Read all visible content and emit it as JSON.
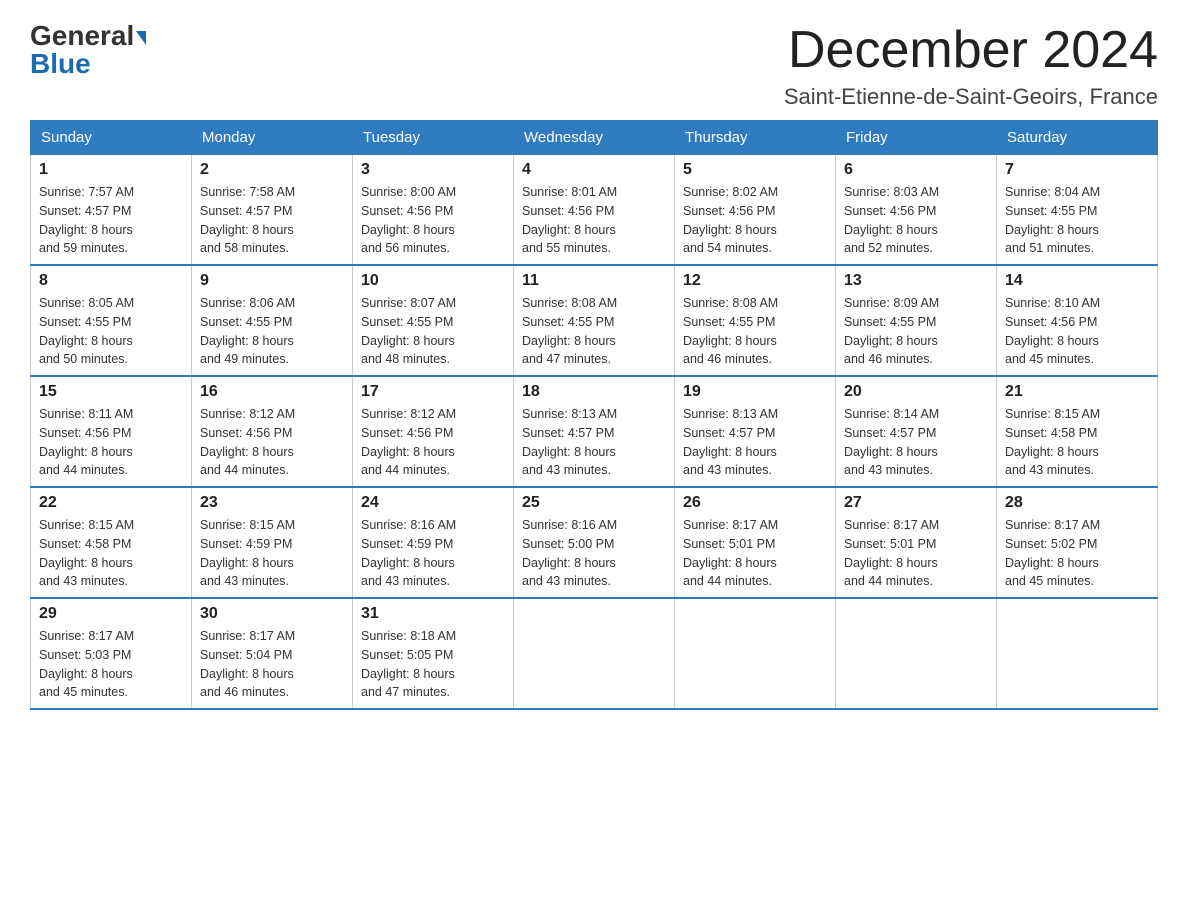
{
  "header": {
    "logo_general": "General",
    "logo_blue": "Blue",
    "title": "December 2024",
    "subtitle": "Saint-Etienne-de-Saint-Geoirs, France"
  },
  "days_of_week": [
    "Sunday",
    "Monday",
    "Tuesday",
    "Wednesday",
    "Thursday",
    "Friday",
    "Saturday"
  ],
  "weeks": [
    [
      {
        "day": "1",
        "sunrise": "7:57 AM",
        "sunset": "4:57 PM",
        "daylight": "8 hours and 59 minutes."
      },
      {
        "day": "2",
        "sunrise": "7:58 AM",
        "sunset": "4:57 PM",
        "daylight": "8 hours and 58 minutes."
      },
      {
        "day": "3",
        "sunrise": "8:00 AM",
        "sunset": "4:56 PM",
        "daylight": "8 hours and 56 minutes."
      },
      {
        "day": "4",
        "sunrise": "8:01 AM",
        "sunset": "4:56 PM",
        "daylight": "8 hours and 55 minutes."
      },
      {
        "day": "5",
        "sunrise": "8:02 AM",
        "sunset": "4:56 PM",
        "daylight": "8 hours and 54 minutes."
      },
      {
        "day": "6",
        "sunrise": "8:03 AM",
        "sunset": "4:56 PM",
        "daylight": "8 hours and 52 minutes."
      },
      {
        "day": "7",
        "sunrise": "8:04 AM",
        "sunset": "4:55 PM",
        "daylight": "8 hours and 51 minutes."
      }
    ],
    [
      {
        "day": "8",
        "sunrise": "8:05 AM",
        "sunset": "4:55 PM",
        "daylight": "8 hours and 50 minutes."
      },
      {
        "day": "9",
        "sunrise": "8:06 AM",
        "sunset": "4:55 PM",
        "daylight": "8 hours and 49 minutes."
      },
      {
        "day": "10",
        "sunrise": "8:07 AM",
        "sunset": "4:55 PM",
        "daylight": "8 hours and 48 minutes."
      },
      {
        "day": "11",
        "sunrise": "8:08 AM",
        "sunset": "4:55 PM",
        "daylight": "8 hours and 47 minutes."
      },
      {
        "day": "12",
        "sunrise": "8:08 AM",
        "sunset": "4:55 PM",
        "daylight": "8 hours and 46 minutes."
      },
      {
        "day": "13",
        "sunrise": "8:09 AM",
        "sunset": "4:55 PM",
        "daylight": "8 hours and 46 minutes."
      },
      {
        "day": "14",
        "sunrise": "8:10 AM",
        "sunset": "4:56 PM",
        "daylight": "8 hours and 45 minutes."
      }
    ],
    [
      {
        "day": "15",
        "sunrise": "8:11 AM",
        "sunset": "4:56 PM",
        "daylight": "8 hours and 44 minutes."
      },
      {
        "day": "16",
        "sunrise": "8:12 AM",
        "sunset": "4:56 PM",
        "daylight": "8 hours and 44 minutes."
      },
      {
        "day": "17",
        "sunrise": "8:12 AM",
        "sunset": "4:56 PM",
        "daylight": "8 hours and 44 minutes."
      },
      {
        "day": "18",
        "sunrise": "8:13 AM",
        "sunset": "4:57 PM",
        "daylight": "8 hours and 43 minutes."
      },
      {
        "day": "19",
        "sunrise": "8:13 AM",
        "sunset": "4:57 PM",
        "daylight": "8 hours and 43 minutes."
      },
      {
        "day": "20",
        "sunrise": "8:14 AM",
        "sunset": "4:57 PM",
        "daylight": "8 hours and 43 minutes."
      },
      {
        "day": "21",
        "sunrise": "8:15 AM",
        "sunset": "4:58 PM",
        "daylight": "8 hours and 43 minutes."
      }
    ],
    [
      {
        "day": "22",
        "sunrise": "8:15 AM",
        "sunset": "4:58 PM",
        "daylight": "8 hours and 43 minutes."
      },
      {
        "day": "23",
        "sunrise": "8:15 AM",
        "sunset": "4:59 PM",
        "daylight": "8 hours and 43 minutes."
      },
      {
        "day": "24",
        "sunrise": "8:16 AM",
        "sunset": "4:59 PM",
        "daylight": "8 hours and 43 minutes."
      },
      {
        "day": "25",
        "sunrise": "8:16 AM",
        "sunset": "5:00 PM",
        "daylight": "8 hours and 43 minutes."
      },
      {
        "day": "26",
        "sunrise": "8:17 AM",
        "sunset": "5:01 PM",
        "daylight": "8 hours and 44 minutes."
      },
      {
        "day": "27",
        "sunrise": "8:17 AM",
        "sunset": "5:01 PM",
        "daylight": "8 hours and 44 minutes."
      },
      {
        "day": "28",
        "sunrise": "8:17 AM",
        "sunset": "5:02 PM",
        "daylight": "8 hours and 45 minutes."
      }
    ],
    [
      {
        "day": "29",
        "sunrise": "8:17 AM",
        "sunset": "5:03 PM",
        "daylight": "8 hours and 45 minutes."
      },
      {
        "day": "30",
        "sunrise": "8:17 AM",
        "sunset": "5:04 PM",
        "daylight": "8 hours and 46 minutes."
      },
      {
        "day": "31",
        "sunrise": "8:18 AM",
        "sunset": "5:05 PM",
        "daylight": "8 hours and 47 minutes."
      },
      null,
      null,
      null,
      null
    ]
  ],
  "labels": {
    "sunrise": "Sunrise:",
    "sunset": "Sunset:",
    "daylight": "Daylight:"
  }
}
